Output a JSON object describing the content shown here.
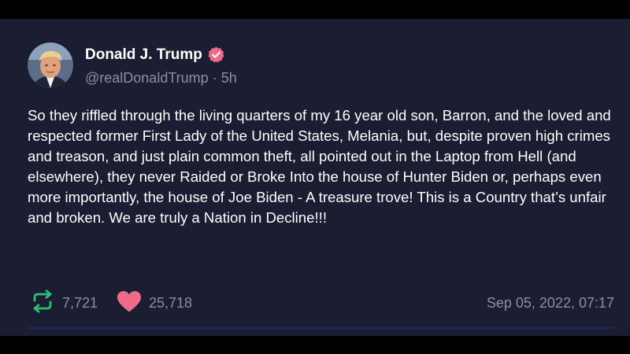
{
  "author": {
    "name": "Donald J. Trump",
    "handle": "@realDonaldTrump",
    "separator": "·",
    "relative_time": "5h",
    "verified": true,
    "avatar_icon": "avatar"
  },
  "post": {
    "text": "So they riffled through the living quarters of my 16 year old son, Barron, and the loved and respected former First Lady of the United States, Melania, but, despite proven high crimes and treason, and just plain common theft, all pointed out in the Laptop from Hell (and elsewhere), they never Raided or Broke Into the house of Hunter Biden or, perhaps even more importantly, the house of Joe Biden - A treasure trove! This is a Country that’s unfair and broken. We are truly a Nation in Decline!!!"
  },
  "stats": {
    "reposts": "7,721",
    "likes": "25,718",
    "repost_icon": "repost-icon",
    "like_icon": "heart-icon"
  },
  "timestamp": "Sep 05, 2022, 07:17",
  "colors": {
    "background": "#1b1d32",
    "text": "#ffffff",
    "muted": "#8a8ea6",
    "repost": "#2fbf71",
    "like": "#f06a8a",
    "verified": "#f06a8a",
    "divider": "#1f2a63"
  }
}
